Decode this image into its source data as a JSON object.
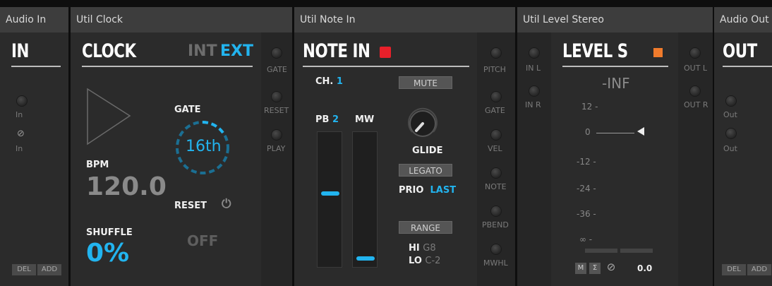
{
  "modules": {
    "audio_in": {
      "header": "Audio In",
      "title": "IN",
      "ports": [
        "In",
        "In"
      ],
      "del": "DEL",
      "add": "ADD"
    },
    "util_clock": {
      "header": "Util Clock",
      "title": "CLOCK",
      "mode_int": "INT",
      "mode_ext": "EXT",
      "gate_label": "GATE",
      "gate_value": "16th",
      "bpm_label": "BPM",
      "bpm_value": "120.0",
      "reset_label": "RESET",
      "reset_value": "OFF",
      "shuffle_label": "SHUFFLE",
      "shuffle_value": "0%",
      "outputs": [
        "GATE",
        "RESET",
        "PLAY"
      ]
    },
    "util_note_in": {
      "header": "Util Note In",
      "title": "NOTE IN",
      "ch_label": "CH.",
      "ch_value": "1",
      "mute": "MUTE",
      "pb_label": "PB",
      "pb_value": "2",
      "mw_label": "MW",
      "glide": "GLIDE",
      "legato": "LEGATO",
      "prio_label": "PRIO",
      "prio_value": "LAST",
      "range": "RANGE",
      "hi_label": "HI",
      "hi_value": "G8",
      "lo_label": "LO",
      "lo_value": "C-2",
      "pb_level": 0.55,
      "mw_level": 0.03,
      "outputs": [
        "PITCH",
        "GATE",
        "VEL",
        "NOTE",
        "PBEND",
        "MWHL"
      ]
    },
    "util_level_stereo": {
      "header": "Util Level Stereo",
      "title": "LEVEL S",
      "inputs": [
        "IN L",
        "IN R"
      ],
      "level_readout": "-INF",
      "scale": [
        "12 -",
        "0",
        "-12 -",
        "-24 -",
        "-36 -",
        "∞ -"
      ],
      "m_btn": "M",
      "sum_btn": "Σ",
      "phase_btn": "⊘",
      "gain_value": "0.0",
      "outputs": [
        "OUT L",
        "OUT R"
      ]
    },
    "audio_out": {
      "header": "Audio Out",
      "title": "OUT",
      "ports": [
        "Out",
        "Out"
      ],
      "del": "DEL",
      "add": "ADD"
    }
  },
  "colors": {
    "accent": "#22b4ef",
    "red_led": "#e8202a",
    "orange_led": "#f07b2c"
  }
}
